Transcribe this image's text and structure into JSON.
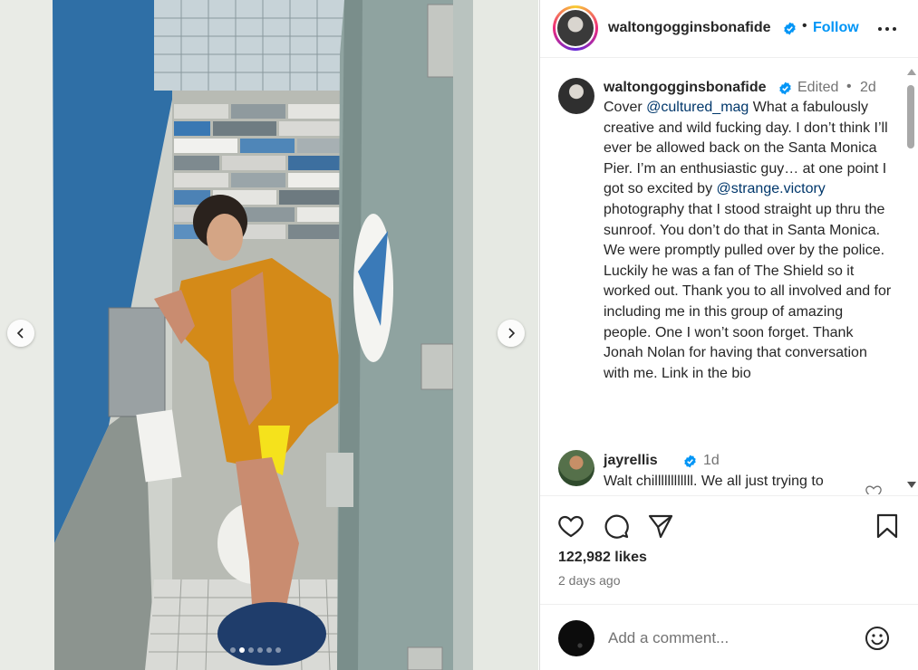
{
  "post": {
    "username": "waltongogginsbonafide",
    "follow_label": "Follow",
    "header_separator": "•"
  },
  "caption": {
    "username": "waltongogginsbonafide",
    "edited_label": "Edited",
    "separator": "•",
    "age": "2d",
    "parts": {
      "p1": "Cover ",
      "m1": "@cultured_mag",
      "p2": " What a fabulously creative and wild fucking day. I don’t think I’ll ever be allowed back on the Santa Monica Pier. I’m an enthusiastic guy… at one point I got so excited by ",
      "m2": "@strange.victory",
      "p3": " photography that I stood straight up thru the sunroof. You don’t do that in Santa Monica. We were promptly pulled over by the police. Luckily he was a fan of The Shield so it worked out. Thank you to all involved and for including me in this group of amazing people. One I won’t soon forget. Thank Jonah Nolan for having that conversation with me. Link in the bio"
    }
  },
  "reply": {
    "username": "jayrellis",
    "age": "1d",
    "text": "Walt chillllllllllll. We all just trying to"
  },
  "stats": {
    "likes": "122,982 likes",
    "time_ago": "2 days ago"
  },
  "comment_box": {
    "placeholder": "Add a comment..."
  },
  "carousel": {
    "slide_count": 6,
    "active_slide": 2
  },
  "colors": {
    "accent": "#0095f6",
    "mention": "#00376b",
    "verified": "#0095f6"
  },
  "icons": {
    "verified": "verified-badge-icon",
    "more": "more-options-icon",
    "like": "heart-icon",
    "comment": "comment-icon",
    "share": "share-icon",
    "save": "bookmark-icon",
    "emoji": "emoji-icon",
    "prev": "chevron-left-icon",
    "next": "chevron-right-icon"
  }
}
